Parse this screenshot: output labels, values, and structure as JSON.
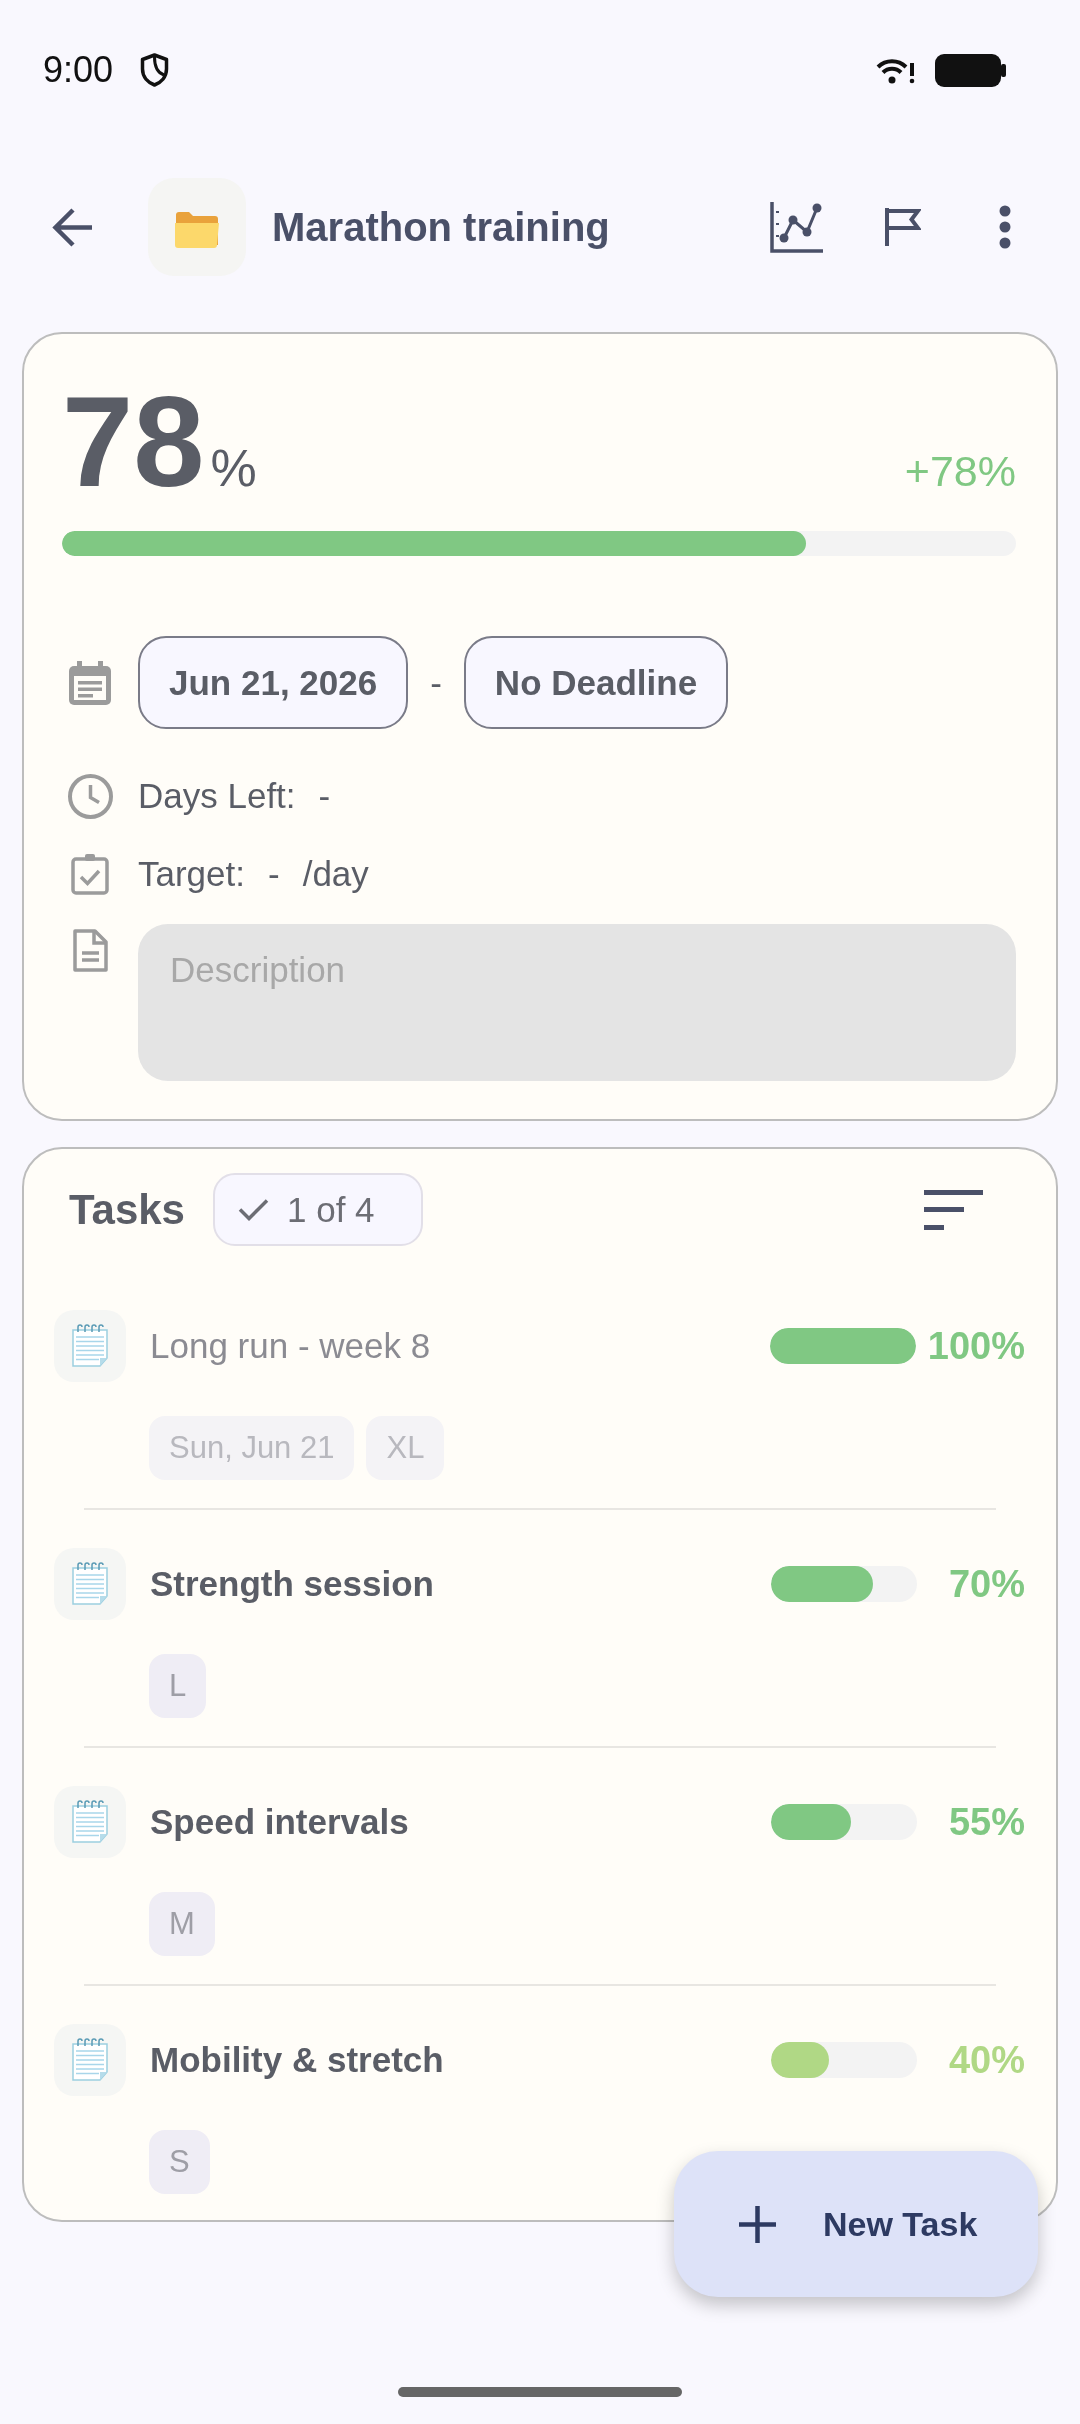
{
  "status_bar": {
    "time": "9:00"
  },
  "header": {
    "title": "Marathon training"
  },
  "progress": {
    "value": "78",
    "unit": "%",
    "change": "+78%",
    "level": 0.78
  },
  "schedule": {
    "start": "Jun 21, 2026",
    "separator": "-",
    "end": "No Deadline"
  },
  "days_left": {
    "label": "Days Left:",
    "value": "-"
  },
  "target": {
    "label": "Target:",
    "value": "-",
    "unit": "/day"
  },
  "description": {
    "placeholder": "Description"
  },
  "tasks": {
    "title": "Tasks",
    "count": "1 of 4",
    "items": [
      {
        "title": "Long run - week 8",
        "done": true,
        "level": 1,
        "percent": "100%",
        "tags": [
          "Sun, Jun 21",
          "XL"
        ]
      },
      {
        "title": "Strength session",
        "done": false,
        "level": 0.7,
        "percent": "70%",
        "tags": [
          "L"
        ]
      },
      {
        "title": "Speed intervals",
        "done": false,
        "level": 0.55,
        "percent": "55%",
        "tags": [
          "M"
        ]
      },
      {
        "title": "Mobility & stretch",
        "done": false,
        "level": 0.4,
        "percent": "40%",
        "tags": [
          "S"
        ]
      }
    ]
  },
  "fab": {
    "label": "New Task"
  }
}
